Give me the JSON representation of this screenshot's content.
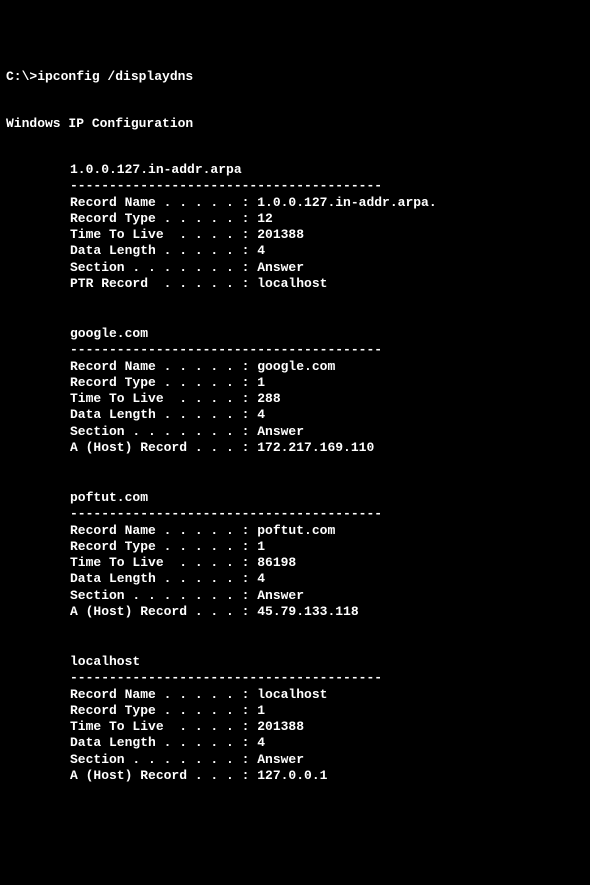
{
  "prompt": "C:\\>ipconfig /displaydns",
  "header": "Windows IP Configuration",
  "separator": "----------------------------------------",
  "labels": {
    "record_name": "Record Name . . . . . :",
    "record_type": "Record Type . . . . . :",
    "ttl": "Time To Live  . . . . :",
    "data_length": "Data Length . . . . . :",
    "section": "Section . . . . . . . :",
    "ptr_record": "PTR Record  . . . . . :",
    "a_host_record": "A (Host) Record . . . :"
  },
  "records": [
    {
      "title": "1.0.0.127.in-addr.arpa",
      "record_name": "1.0.0.127.in-addr.arpa.",
      "record_type": "12",
      "ttl": "201388",
      "data_length": "4",
      "section": "Answer",
      "final_label": "ptr_record",
      "final_value": "localhost"
    },
    {
      "title": "google.com",
      "record_name": "google.com",
      "record_type": "1",
      "ttl": "288",
      "data_length": "4",
      "section": "Answer",
      "final_label": "a_host_record",
      "final_value": "172.217.169.110"
    },
    {
      "title": "poftut.com",
      "record_name": "poftut.com",
      "record_type": "1",
      "ttl": "86198",
      "data_length": "4",
      "section": "Answer",
      "final_label": "a_host_record",
      "final_value": "45.79.133.118"
    },
    {
      "title": "localhost",
      "record_name": "localhost",
      "record_type": "1",
      "ttl": "201388",
      "data_length": "4",
      "section": "Answer",
      "final_label": "a_host_record",
      "final_value": "127.0.0.1"
    }
  ]
}
